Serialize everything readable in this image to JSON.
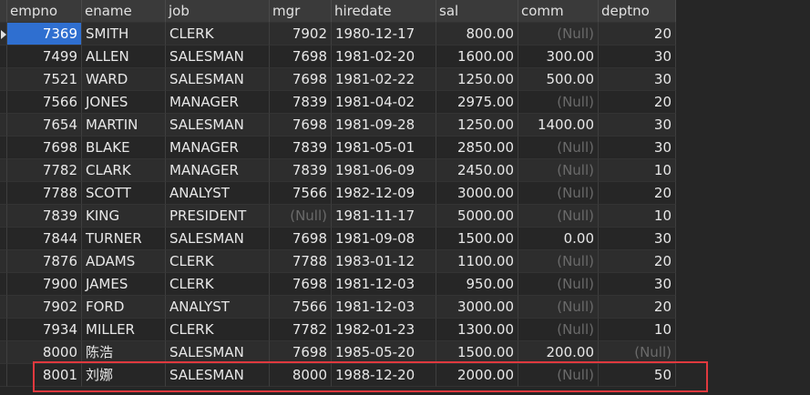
{
  "columns": [
    "empno",
    "ename",
    "job",
    "mgr",
    "hiredate",
    "sal",
    "comm",
    "deptno"
  ],
  "null_label": "(Null)",
  "rows": [
    [
      "7369",
      "SMITH",
      "CLERK",
      "7902",
      "1980-12-17",
      "800.00",
      "(Null)",
      "20"
    ],
    [
      "7499",
      "ALLEN",
      "SALESMAN",
      "7698",
      "1981-02-20",
      "1600.00",
      "300.00",
      "30"
    ],
    [
      "7521",
      "WARD",
      "SALESMAN",
      "7698",
      "1981-02-22",
      "1250.00",
      "500.00",
      "30"
    ],
    [
      "7566",
      "JONES",
      "MANAGER",
      "7839",
      "1981-04-02",
      "2975.00",
      "(Null)",
      "20"
    ],
    [
      "7654",
      "MARTIN",
      "SALESMAN",
      "7698",
      "1981-09-28",
      "1250.00",
      "1400.00",
      "30"
    ],
    [
      "7698",
      "BLAKE",
      "MANAGER",
      "7839",
      "1981-05-01",
      "2850.00",
      "(Null)",
      "30"
    ],
    [
      "7782",
      "CLARK",
      "MANAGER",
      "7839",
      "1981-06-09",
      "2450.00",
      "(Null)",
      "10"
    ],
    [
      "7788",
      "SCOTT",
      "ANALYST",
      "7566",
      "1982-12-09",
      "3000.00",
      "(Null)",
      "20"
    ],
    [
      "7839",
      "KING",
      "PRESIDENT",
      "(Null)",
      "1981-11-17",
      "5000.00",
      "(Null)",
      "10"
    ],
    [
      "7844",
      "TURNER",
      "SALESMAN",
      "7698",
      "1981-09-08",
      "1500.00",
      "0.00",
      "30"
    ],
    [
      "7876",
      "ADAMS",
      "CLERK",
      "7788",
      "1983-01-12",
      "1100.00",
      "(Null)",
      "20"
    ],
    [
      "7900",
      "JAMES",
      "CLERK",
      "7698",
      "1981-12-03",
      "950.00",
      "(Null)",
      "30"
    ],
    [
      "7902",
      "FORD",
      "ANALYST",
      "7566",
      "1981-12-03",
      "3000.00",
      "(Null)",
      "20"
    ],
    [
      "7934",
      "MILLER",
      "CLERK",
      "7782",
      "1982-01-23",
      "1300.00",
      "(Null)",
      "10"
    ],
    [
      "8000",
      "陈浩",
      "SALESMAN",
      "7698",
      "1985-05-20",
      "1500.00",
      "200.00",
      "(Null)"
    ],
    [
      "8001",
      "刘娜",
      "SALESMAN",
      "8000",
      "1988-12-20",
      "2000.00",
      "(Null)",
      "50"
    ]
  ],
  "colors": {
    "background": "#262626",
    "selected_cell": "#2f6fd0",
    "null_text": "#6a6a6a",
    "highlight_border": "#e0393e"
  }
}
